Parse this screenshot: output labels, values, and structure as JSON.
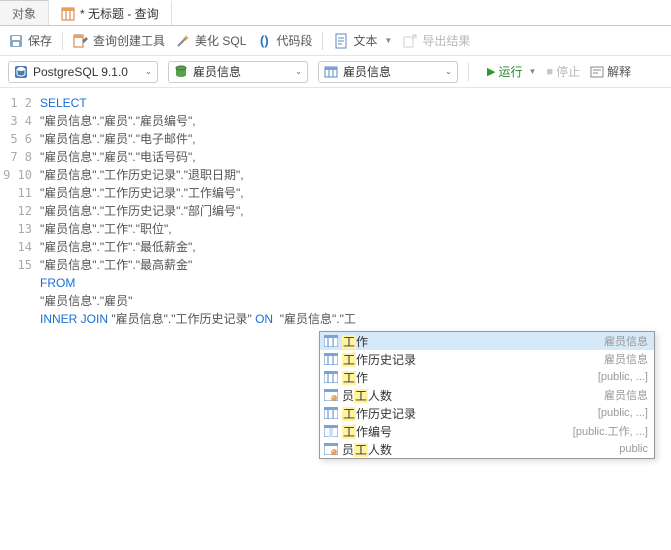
{
  "tabs": {
    "objects": "对象",
    "query": "* 无标题 - 查询"
  },
  "toolbar": {
    "save": "保存",
    "query_builder": "查询创建工具",
    "beautify": "美化 SQL",
    "snippet": "代码段",
    "text": "文本",
    "export": "导出结果"
  },
  "dropdowns": {
    "db": "PostgreSQL 9.1.0",
    "schema": "雇员信息",
    "table": "雇员信息"
  },
  "actions": {
    "run": "运行",
    "stop": "停止",
    "explain": "解释"
  },
  "code": {
    "lines": [
      {
        "n": 1,
        "t": "SELECT",
        "cls": "kw"
      },
      {
        "n": 2,
        "t": "\"雇员信息\".\"雇员\".\"雇员编号\",",
        "cls": "str"
      },
      {
        "n": 3,
        "t": "\"雇员信息\".\"雇员\".\"电子邮件\",",
        "cls": "str"
      },
      {
        "n": 4,
        "t": "\"雇员信息\".\"雇员\".\"电话号码\",",
        "cls": "str"
      },
      {
        "n": 5,
        "t": "\"雇员信息\".\"工作历史记录\".\"退职日期\",",
        "cls": "str"
      },
      {
        "n": 6,
        "t": "\"雇员信息\".\"工作历史记录\".\"工作编号\",",
        "cls": "str"
      },
      {
        "n": 7,
        "t": "\"雇员信息\".\"工作历史记录\".\"部门编号\",",
        "cls": "str"
      },
      {
        "n": 8,
        "t": "\"雇员信息\".\"工作\".\"职位\",",
        "cls": "str"
      },
      {
        "n": 9,
        "t": "\"雇员信息\".\"工作\".\"最低薪金\",",
        "cls": "str"
      },
      {
        "n": 10,
        "t": "\"雇员信息\".\"工作\".\"最高薪金\"",
        "cls": "str"
      },
      {
        "n": 11,
        "t": "FROM",
        "cls": "kw"
      },
      {
        "n": 12,
        "t": "\"雇员信息\".\"雇员\"",
        "cls": "str"
      }
    ],
    "line13_join": "INNER JOIN ",
    "line13_mid": "\"雇员信息\".\"工作历史记录\" ",
    "line13_on": "ON ",
    "line13_after": " \"雇员信息\".\"工"
  },
  "autocomplete": {
    "items": [
      {
        "pre": "",
        "hl": "工",
        "post": "作",
        "schema": "雇员信息",
        "icon": "table",
        "sel": true
      },
      {
        "pre": "",
        "hl": "工",
        "post": "作历史记录",
        "schema": "雇员信息",
        "icon": "table"
      },
      {
        "pre": "",
        "hl": "工",
        "post": "作",
        "schema": "[public, ...]",
        "icon": "table"
      },
      {
        "pre": "员",
        "hl": "工",
        "post": "人数",
        "schema": "雇员信息",
        "icon": "view"
      },
      {
        "pre": "",
        "hl": "工",
        "post": "作历史记录",
        "schema": "[public, ...]",
        "icon": "table"
      },
      {
        "pre": "",
        "hl": "工",
        "post": "作编号",
        "schema": "[public.工作, ...]",
        "icon": "column"
      },
      {
        "pre": "员",
        "hl": "工",
        "post": "人数",
        "schema": "public",
        "icon": "view"
      }
    ]
  }
}
